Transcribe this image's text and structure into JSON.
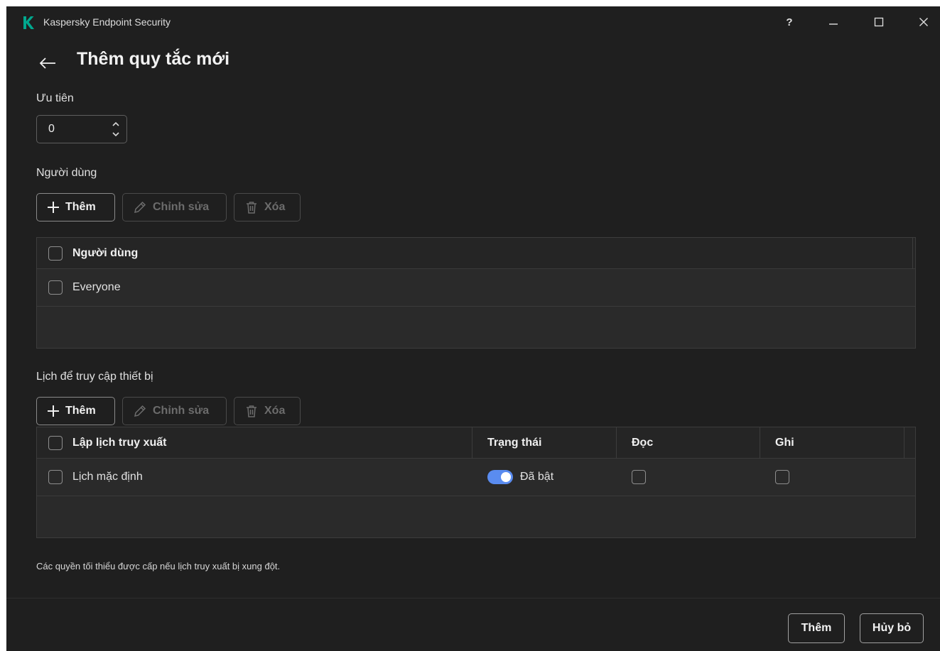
{
  "window": {
    "title": "Kaspersky Endpoint Security",
    "brand_color": "#00a88e",
    "controls": {
      "help": "?",
      "minimize_icon": "minimize-icon",
      "maximize_icon": "maximize-icon",
      "close_icon": "close-icon"
    }
  },
  "page": {
    "title": "Thêm quy tắc mới",
    "back_icon": "arrow-left-icon"
  },
  "priority": {
    "label": "Ưu tiên",
    "value": "0"
  },
  "users": {
    "label": "Người dùng",
    "toolbar": {
      "add": "Thêm",
      "edit": "Chỉnh sửa",
      "delete": "Xóa"
    },
    "table": {
      "header": "Người dùng",
      "rows": [
        "Everyone"
      ]
    }
  },
  "schedule": {
    "label": "Lịch để truy cập thiết bị",
    "toolbar": {
      "add": "Thêm",
      "edit": "Chỉnh sửa",
      "delete": "Xóa"
    },
    "table": {
      "columns": [
        "Lập lịch truy xuất",
        "Trạng thái",
        "Đọc",
        "Ghi"
      ],
      "rows": [
        {
          "name": "Lịch mặc định",
          "status": "Đã bật",
          "enabled": true,
          "read": false,
          "write": false
        }
      ]
    }
  },
  "note": "Các quyền tối thiểu được cấp nếu lịch truy xuất bị xung đột.",
  "footer": {
    "add": "Thêm",
    "cancel": "Hủy bỏ"
  },
  "colors": {
    "background": "#1f1f1f",
    "toggle_on": "#5a8cf0"
  }
}
